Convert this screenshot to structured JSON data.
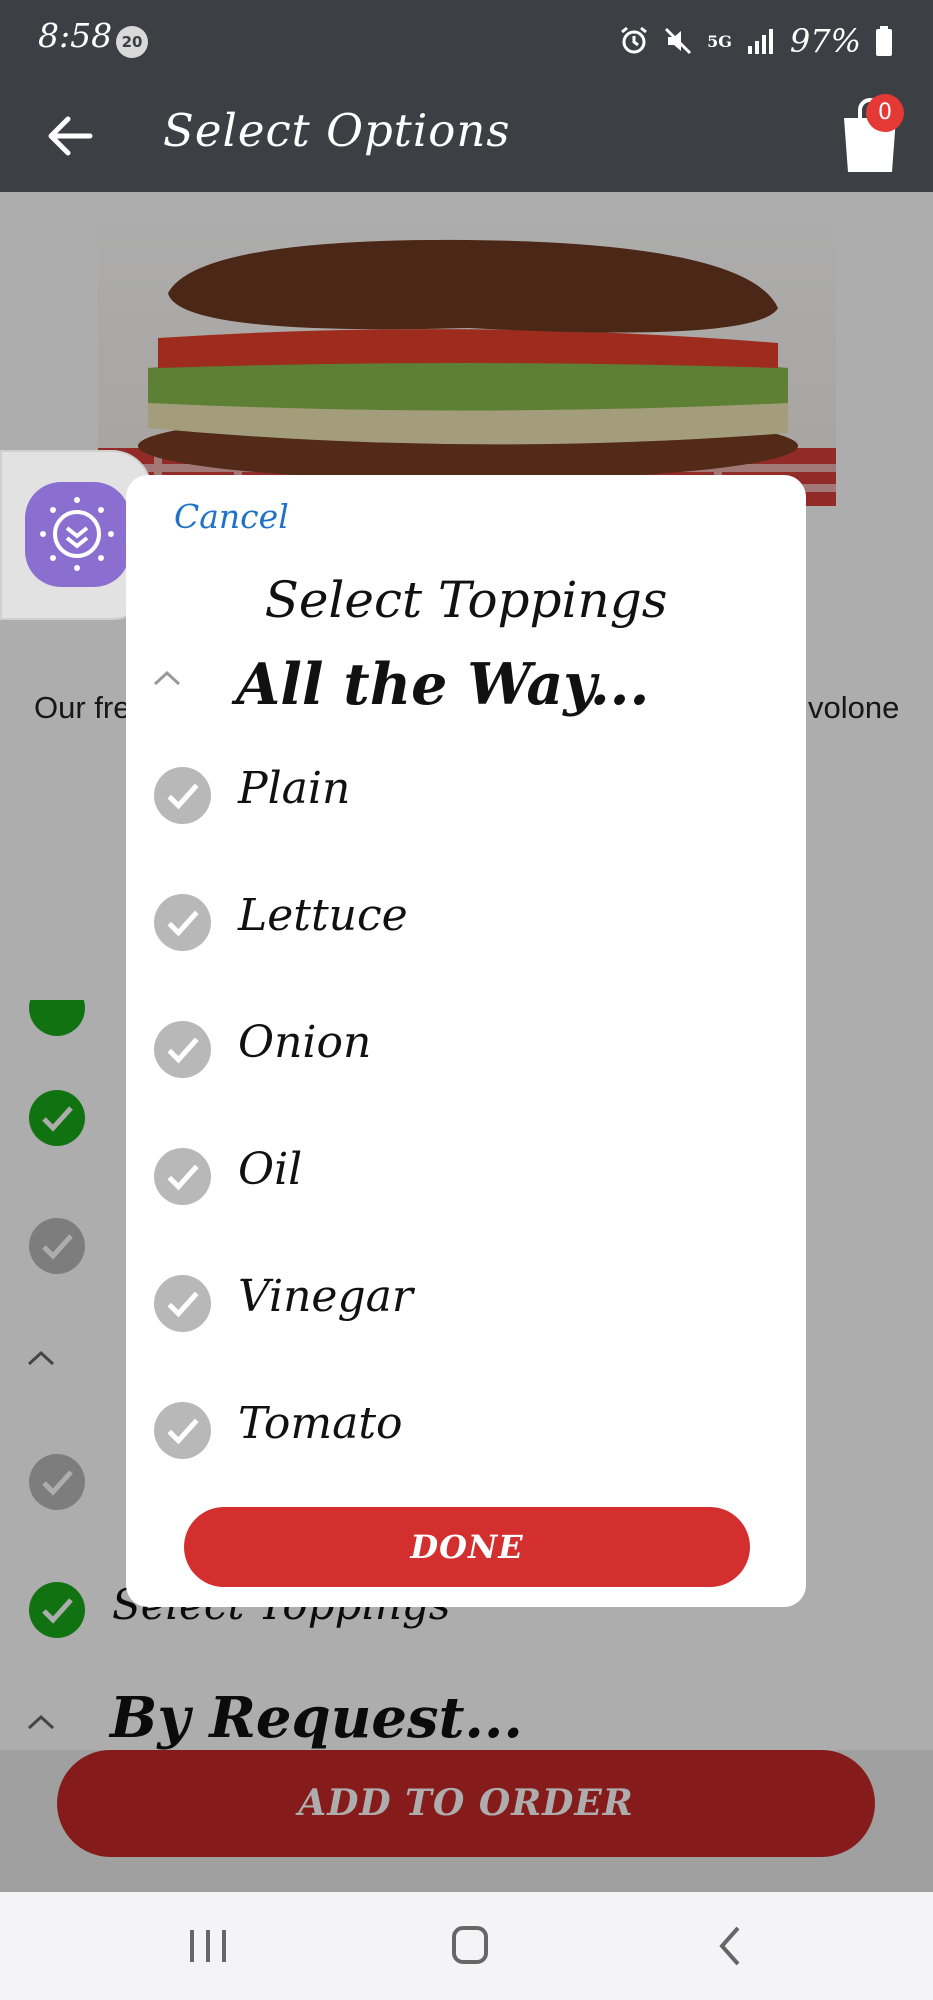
{
  "status_bar": {
    "time": "8:58",
    "notification_count": "20",
    "network": "5G",
    "battery": "97%"
  },
  "header": {
    "title": "Select Options",
    "cart_count": "0"
  },
  "background": {
    "description_left": "Our fre",
    "description_right": "volone",
    "select_toppings_label": "Select Toppings",
    "by_request_label": "By Request...",
    "add_to_order_label": "ADD TO ORDER"
  },
  "modal": {
    "cancel_label": "Cancel",
    "title": "Select Toppings",
    "group_label": "All the Way...",
    "options": [
      {
        "label": "Plain"
      },
      {
        "label": "Lettuce"
      },
      {
        "label": "Onion"
      },
      {
        "label": "Oil"
      },
      {
        "label": "Vinegar"
      },
      {
        "label": "Tomato"
      }
    ],
    "done_label": "DONE"
  },
  "colors": {
    "header_bg": "#3c3f44",
    "accent_red": "#d32f2f",
    "link_blue": "#1e72c9",
    "check_green": "#1aa81a",
    "check_gray": "#b8b8b8",
    "assistant_purple": "#8a6fd1"
  }
}
